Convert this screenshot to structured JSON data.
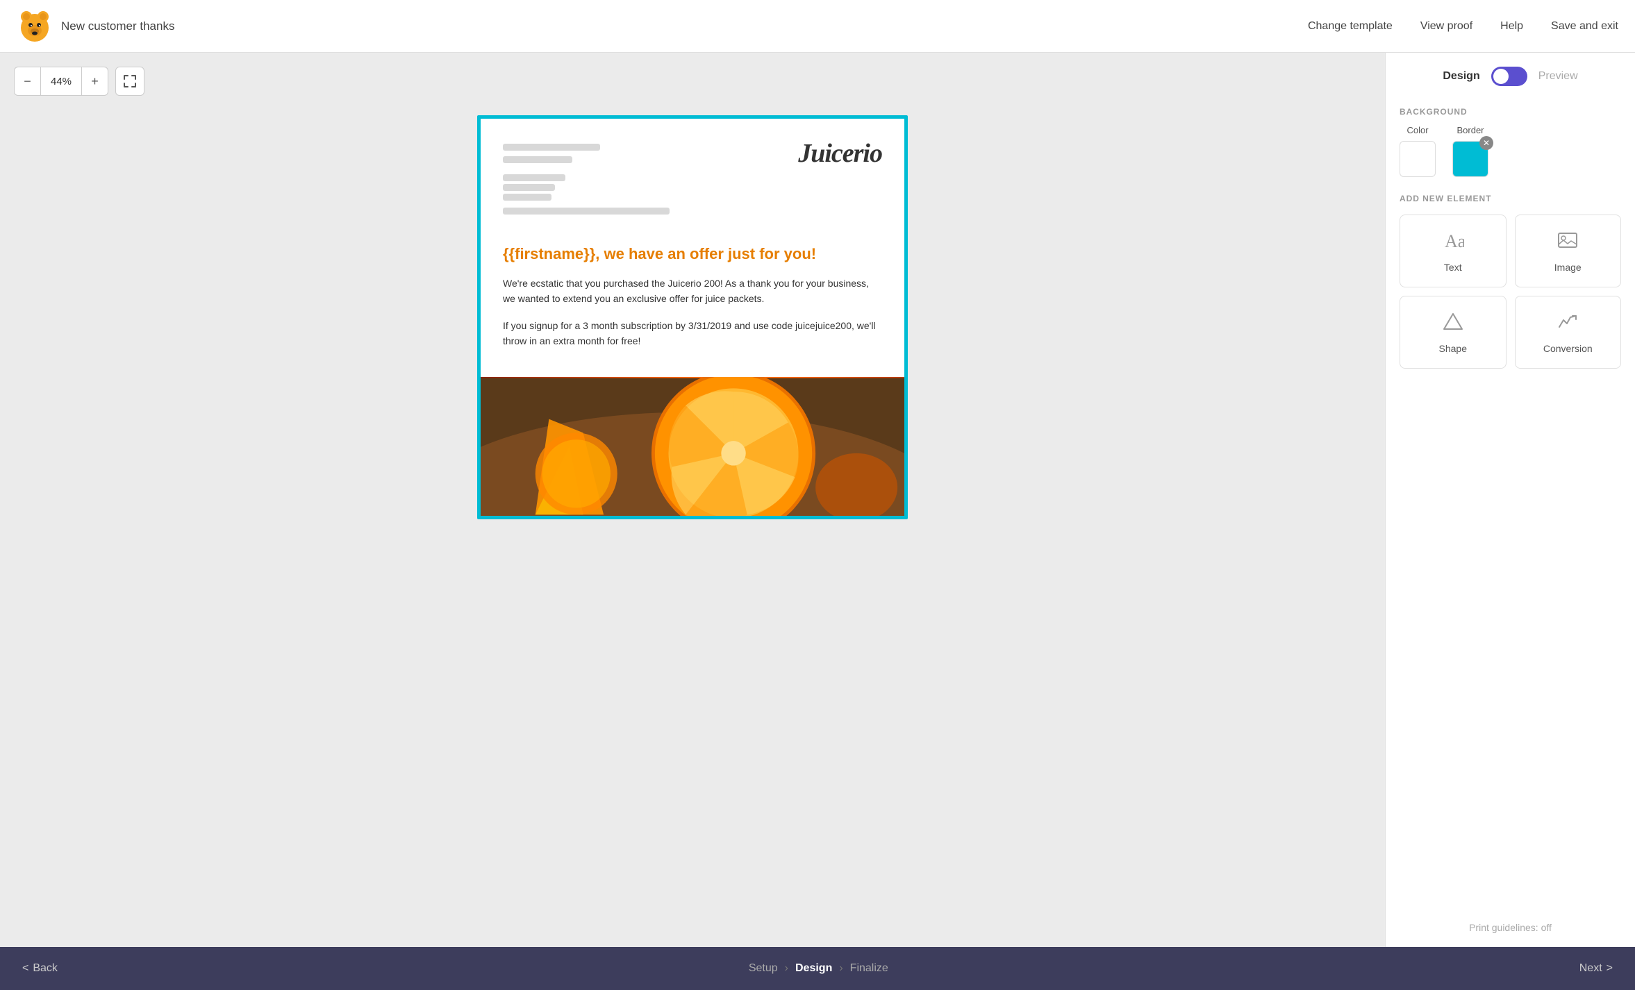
{
  "header": {
    "doc_title": "New customer thanks",
    "nav_items": [
      {
        "id": "change-template",
        "label": "Change template"
      },
      {
        "id": "view-proof",
        "label": "View proof"
      },
      {
        "id": "help",
        "label": "Help"
      },
      {
        "id": "save-exit",
        "label": "Save and exit"
      }
    ]
  },
  "zoom": {
    "decrease_label": "−",
    "value": "44%",
    "increase_label": "+",
    "fullscreen_icon": "⛶"
  },
  "email": {
    "logo": "Juicerio",
    "greeting": "{{firstname}}, we have an offer just for you!",
    "paragraph1": "We're ecstatic that you purchased the Juicerio 200! As a thank you for your business, we wanted to extend you an exclusive offer for juice packets.",
    "paragraph2": "If you signup for a 3 month subscription by 3/31/2019 and use code juicejuice200, we'll throw in an extra month for free!"
  },
  "right_panel": {
    "design_label": "Design",
    "preview_label": "Preview",
    "toggle_state": "design",
    "background": {
      "section_label": "BACKGROUND",
      "color_label": "Color",
      "border_label": "Border",
      "color_value": "#ffffff",
      "border_value": "#00bcd4"
    },
    "add_element": {
      "section_label": "ADD NEW ELEMENT",
      "items": [
        {
          "id": "text",
          "label": "Text",
          "icon": "text"
        },
        {
          "id": "image",
          "label": "Image",
          "icon": "image"
        },
        {
          "id": "shape",
          "label": "Shape",
          "icon": "shape"
        },
        {
          "id": "conversion",
          "label": "Conversion",
          "icon": "conversion"
        }
      ]
    },
    "print_guidelines": "Print guidelines: off"
  },
  "bottom_bar": {
    "back_label": "Back",
    "back_icon": "<",
    "steps": [
      {
        "id": "setup",
        "label": "Setup",
        "active": false
      },
      {
        "id": "design",
        "label": "Design",
        "active": true
      },
      {
        "id": "finalize",
        "label": "Finalize",
        "active": false
      }
    ],
    "next_label": "Next",
    "next_icon": ">"
  }
}
